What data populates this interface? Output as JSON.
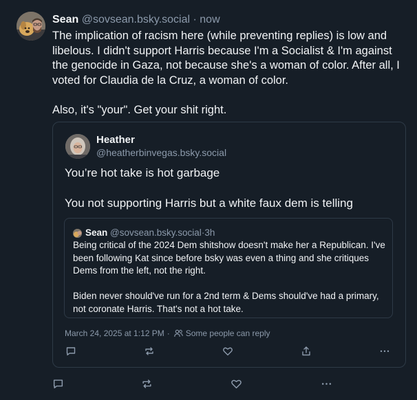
{
  "post": {
    "author_name": "Sean",
    "author_handle": "@sovsean.bsky.social",
    "time_sep": " · ",
    "time": "now",
    "paragraphs": [
      "The implication of racism here (while preventing replies) is low and libelous. I didn't support Harris because I'm a Socialist & I'm against the genocide in Gaza, not because she's a woman of color. After all, I voted for Claudia de la Cruz, a woman of color.",
      "Also, it's \"your\". Get your shit right."
    ],
    "actions": [
      "reply-icon",
      "repost-icon",
      "like-icon",
      "more-icon"
    ]
  },
  "quote": {
    "author_name": "Heather",
    "author_handle": "@heatherbinvegas.bsky.social",
    "paragraphs": [
      "You’re hot take is hot garbage",
      "You not supporting Harris but a white faux dem is telling"
    ],
    "inner": {
      "author_name": "Sean",
      "author_handle": "@sovsean.bsky.social",
      "time_sep": " · ",
      "time": "3h",
      "paragraphs": [
        "Being critical of the 2024 Dem shitshow doesn't make her a Republican. I've been following Kat since before bsky was even a thing and she critiques Dems from the left, not the right.",
        "Biden never should've run for a 2nd term & Dems should've had a primary, not coronate Harris. That's not a hot take."
      ]
    },
    "timestamp": "March 24, 2025 at 1:12 PM",
    "reply_setting": "Some people can reply",
    "actions": [
      "reply-icon",
      "repost-icon",
      "like-icon",
      "share-icon",
      "more-icon"
    ]
  },
  "colors": {
    "background": "#161e27",
    "text": "#f1f3f5",
    "muted": "#8c9aab",
    "border": "#2e3a47"
  }
}
